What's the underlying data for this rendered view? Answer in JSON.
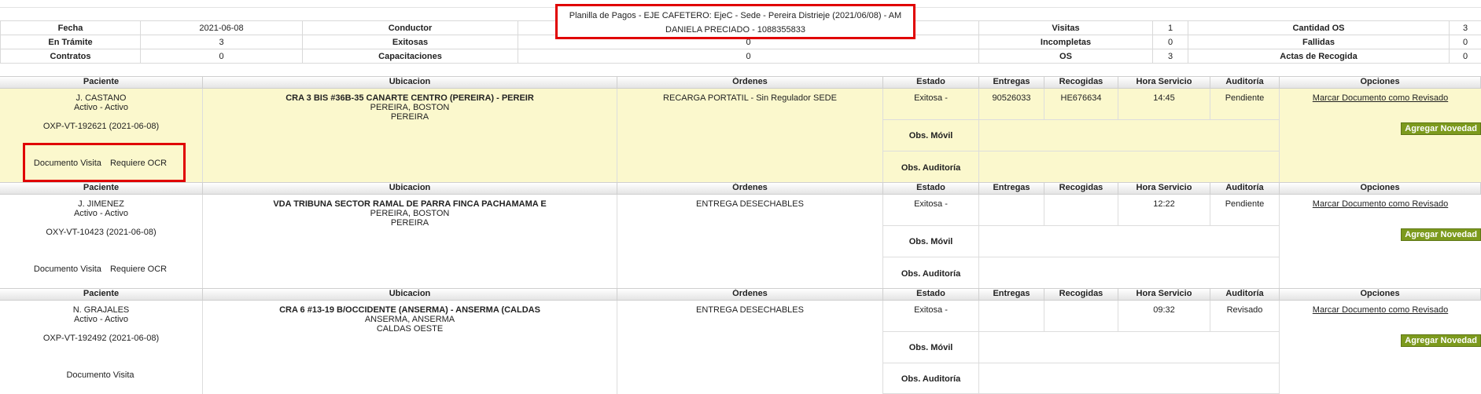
{
  "header": {
    "title": "Planilla de Pagos - EJE CAFETERO: EjeC - Sede - Pereira Distrieje (2021/06/08) - AM",
    "driver": "DANIELA PRECIADO - 1088355833"
  },
  "summary": {
    "rows": [
      [
        "Fecha",
        "2021-06-08",
        "Conductor",
        "",
        "Visitas",
        "1",
        "Cantidad OS",
        "3"
      ],
      [
        "En Trámite",
        "3",
        "Exitosas",
        "0",
        "Incompletas",
        "0",
        "Fallidas",
        "0"
      ],
      [
        "Contratos",
        "0",
        "Capacitaciones",
        "0",
        "OS",
        "3",
        "Actas de Recogida",
        "0"
      ]
    ]
  },
  "columns": {
    "paciente": "Paciente",
    "ubicacion": "Ubicacion",
    "ordenes": "Órdenes",
    "estado": "Estado",
    "entregas": "Entregas",
    "recogidas": "Recogidas",
    "hora": "Hora Servicio",
    "auditoria": "Auditoría",
    "opciones": "Opciones"
  },
  "labels": {
    "obs_movil": "Obs. Móvil",
    "obs_auditoria": "Obs. Auditoría",
    "mark_reviewed": "Marcar Documento como Revisado",
    "add_news": "Agregar Novedad",
    "doc_visit": "Documento Visita",
    "requires_ocr": "Requiere OCR"
  },
  "records": [
    {
      "name": "J. CASTANO",
      "status": "Activo - Activo",
      "code": "OXP-VT-192621 (2021-06-08)",
      "address": "CRA 3 BIS #36B-35 CANARTE CENTRO (PEREIRA) - PEREIR",
      "city": "PEREIRA, BOSTON",
      "region": "PEREIRA",
      "order": "RECARGA PORTATIL - Sin Regulador SEDE",
      "estado": "Exitosa -",
      "entregas": "90526033",
      "recogidas": "HE676634",
      "hora": "14:45",
      "auditoria": "Pendiente"
    },
    {
      "name": "J. JIMENEZ",
      "status": "Activo - Activo",
      "code": "OXY-VT-10423 (2021-06-08)",
      "address": "VDA TRIBUNA SECTOR RAMAL DE PARRA FINCA PACHAMAMA E",
      "city": "PEREIRA, BOSTON",
      "region": "PEREIRA",
      "order": "ENTREGA DESECHABLES",
      "estado": "Exitosa -",
      "entregas": "",
      "recogidas": "",
      "hora": "12:22",
      "auditoria": "Pendiente"
    },
    {
      "name": "N. GRAJALES",
      "status": "Activo - Activo",
      "code": "OXP-VT-192492 (2021-06-08)",
      "address": "CRA 6 #13-19 B/OCCIDENTE (ANSERMA) - ANSERMA (CALDAS",
      "city": "ANSERMA, ANSERMA",
      "region": "CALDAS OESTE",
      "order": "ENTREGA DESECHABLES",
      "estado": "Exitosa -",
      "entregas": "",
      "recogidas": "",
      "hora": "09:32",
      "auditoria": "Revisado"
    }
  ],
  "colors": {
    "highlight": "#fbf8cd",
    "button": "#7c9a1d",
    "annotation": "#e00000"
  }
}
